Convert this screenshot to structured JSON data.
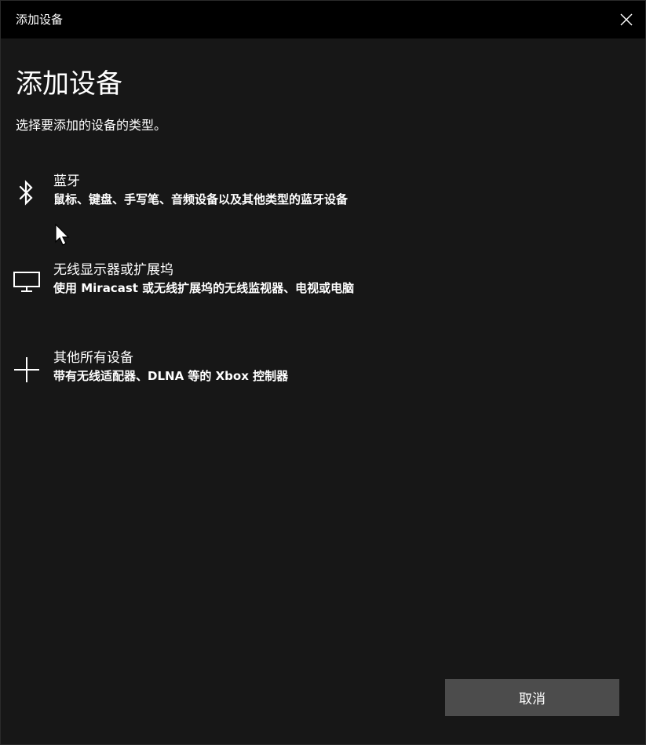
{
  "window": {
    "title": "添加设备"
  },
  "page": {
    "heading": "添加设备",
    "subtitle": "选择要添加的设备的类型。"
  },
  "options": [
    {
      "icon": "bluetooth-icon",
      "title": "蓝牙",
      "description": "鼠标、键盘、手写笔、音频设备以及其他类型的蓝牙设备"
    },
    {
      "icon": "monitor-icon",
      "title": "无线显示器或扩展坞",
      "description": "使用 Miracast 或无线扩展坞的无线监视器、电视或电脑"
    },
    {
      "icon": "plus-icon",
      "title": "其他所有设备",
      "description": "带有无线适配器、DLNA 等的 Xbox 控制器"
    }
  ],
  "footer": {
    "cancel_label": "取消"
  },
  "colors": {
    "background": "#171717",
    "titlebar": "#000000",
    "button": "#4c4c4c",
    "text": "#ffffff"
  }
}
